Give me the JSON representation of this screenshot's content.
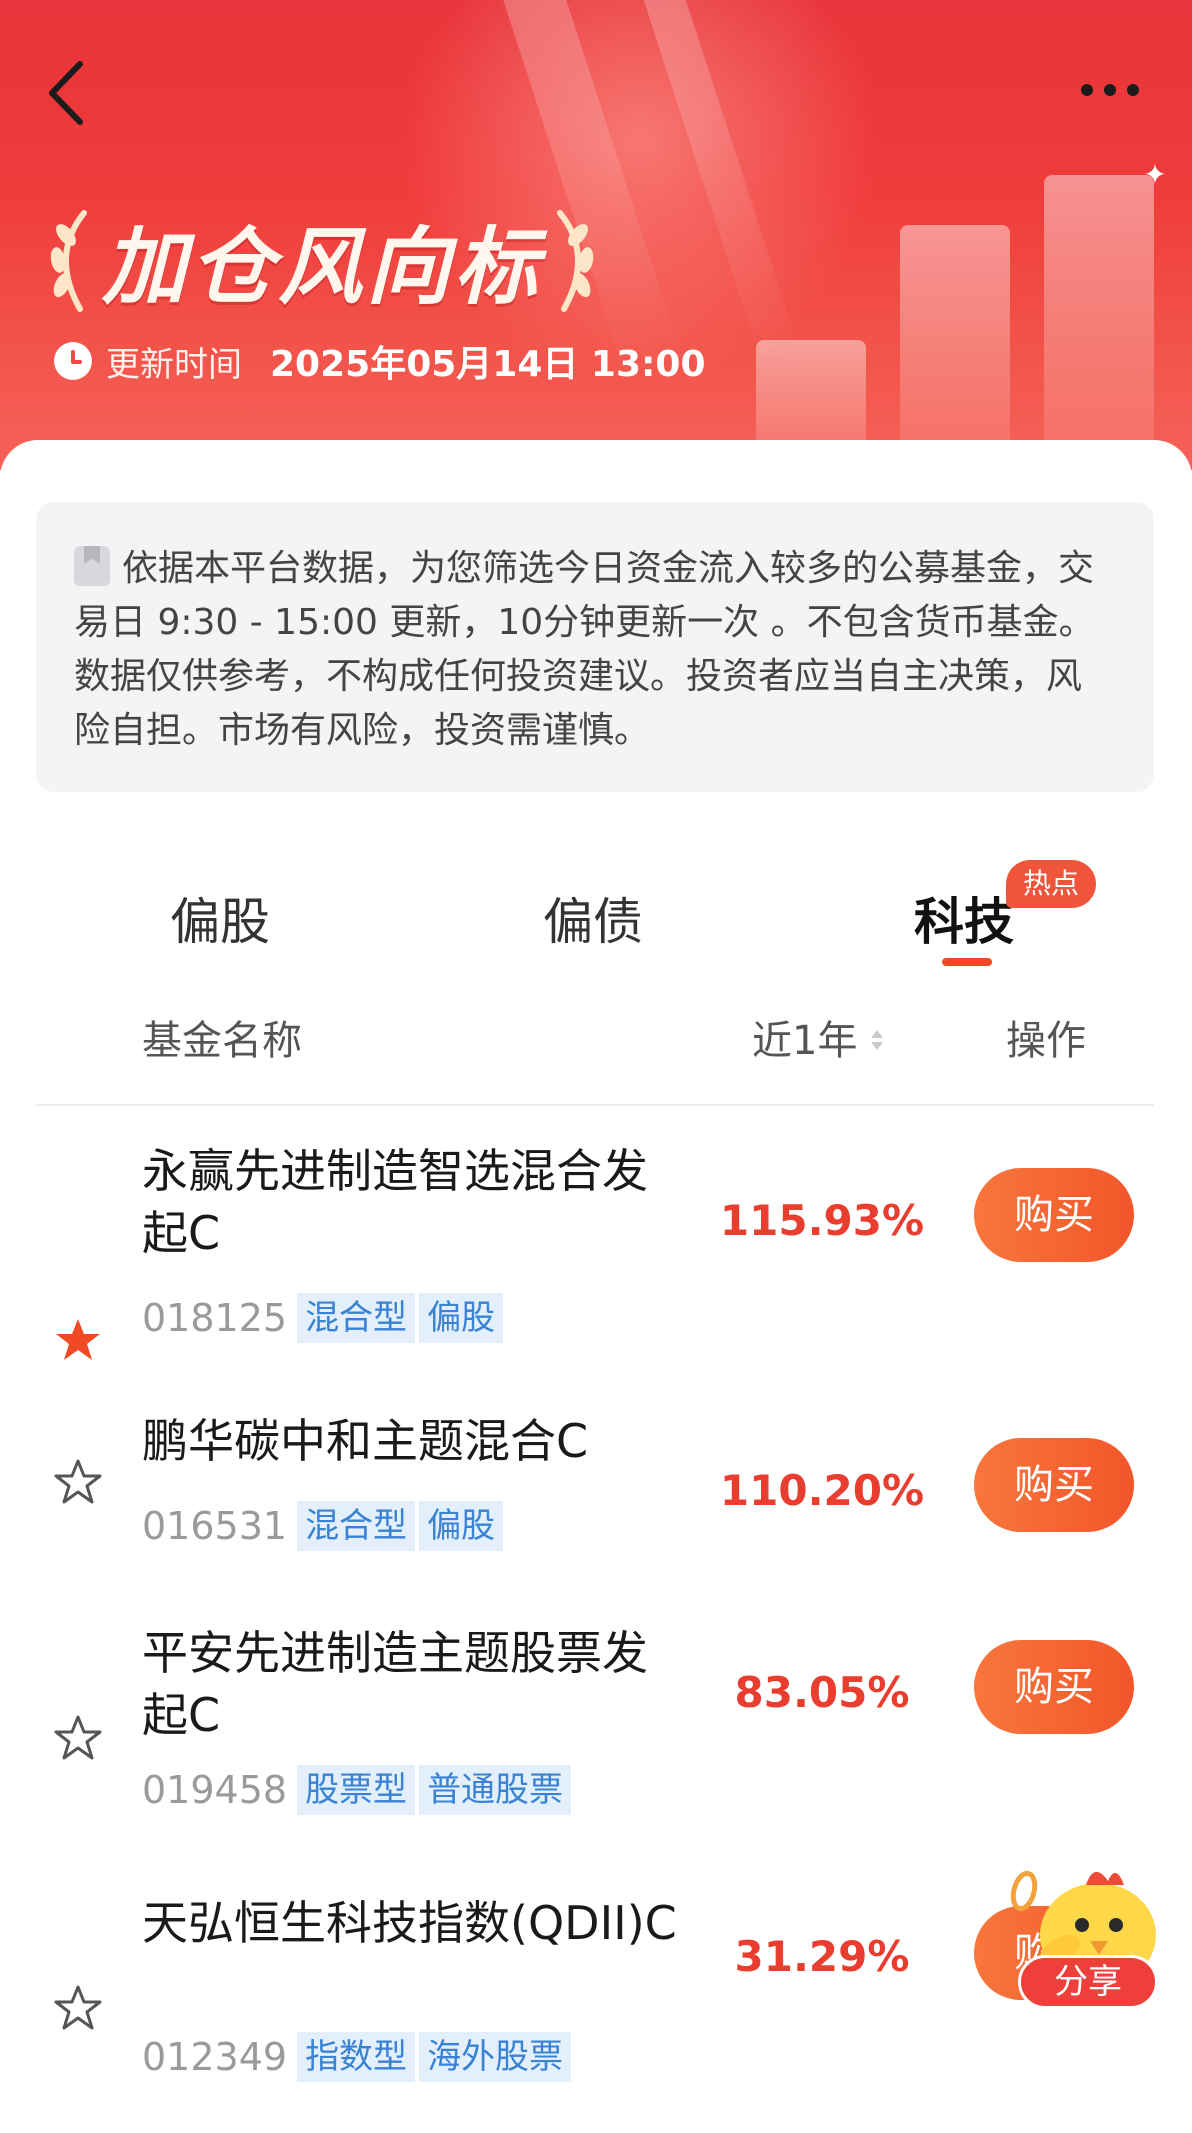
{
  "header": {
    "title": "加仓风向标",
    "update_label": "更新时间",
    "update_time": "2025年05月14日 13:00",
    "background_color": "#ef3a3a"
  },
  "notice": {
    "text": "依据本平台数据，为您筛选今日资金流入较多的公募基金，交易日 9:30 - 15:00 更新，10分钟更新一次 。不包含货币基金。数据仅供参考，不构成任何投资建议。投资者应当自主决策，风险自担。市场有风险，投资需谨慎。"
  },
  "tabs": [
    {
      "label": "偏股",
      "active": false
    },
    {
      "label": "偏债",
      "active": false
    },
    {
      "label": "科技",
      "active": true,
      "badge": "热点"
    }
  ],
  "table": {
    "columns": {
      "name": "基金名称",
      "return": "近1年",
      "action": "操作"
    },
    "rows": [
      {
        "name": "永赢先进制造智选混合发起C",
        "code": "018125",
        "tags": [
          "混合型",
          "偏股"
        ],
        "return": "115.93%",
        "action": "购买",
        "starred": true
      },
      {
        "name": "鹏华碳中和主题混合C",
        "code": "016531",
        "tags": [
          "混合型",
          "偏股"
        ],
        "return": "110.20%",
        "action": "购买",
        "starred": false
      },
      {
        "name": "平安先进制造主题股票发起C",
        "code": "019458",
        "tags": [
          "股票型",
          "普通股票"
        ],
        "return": "83.05%",
        "action": "购买",
        "starred": false
      },
      {
        "name": "天弘恒生科技指数(QDII)C",
        "code": "012349",
        "tags": [
          "指数型",
          "海外股票"
        ],
        "return": "31.29%",
        "action": "购买",
        "starred": false
      }
    ]
  },
  "share": {
    "label": "分享"
  },
  "colors": {
    "accent": "#f04a24",
    "return_red": "#e83d2f",
    "tag_blue": "#3a82d4",
    "buy_button": "#f46232"
  }
}
